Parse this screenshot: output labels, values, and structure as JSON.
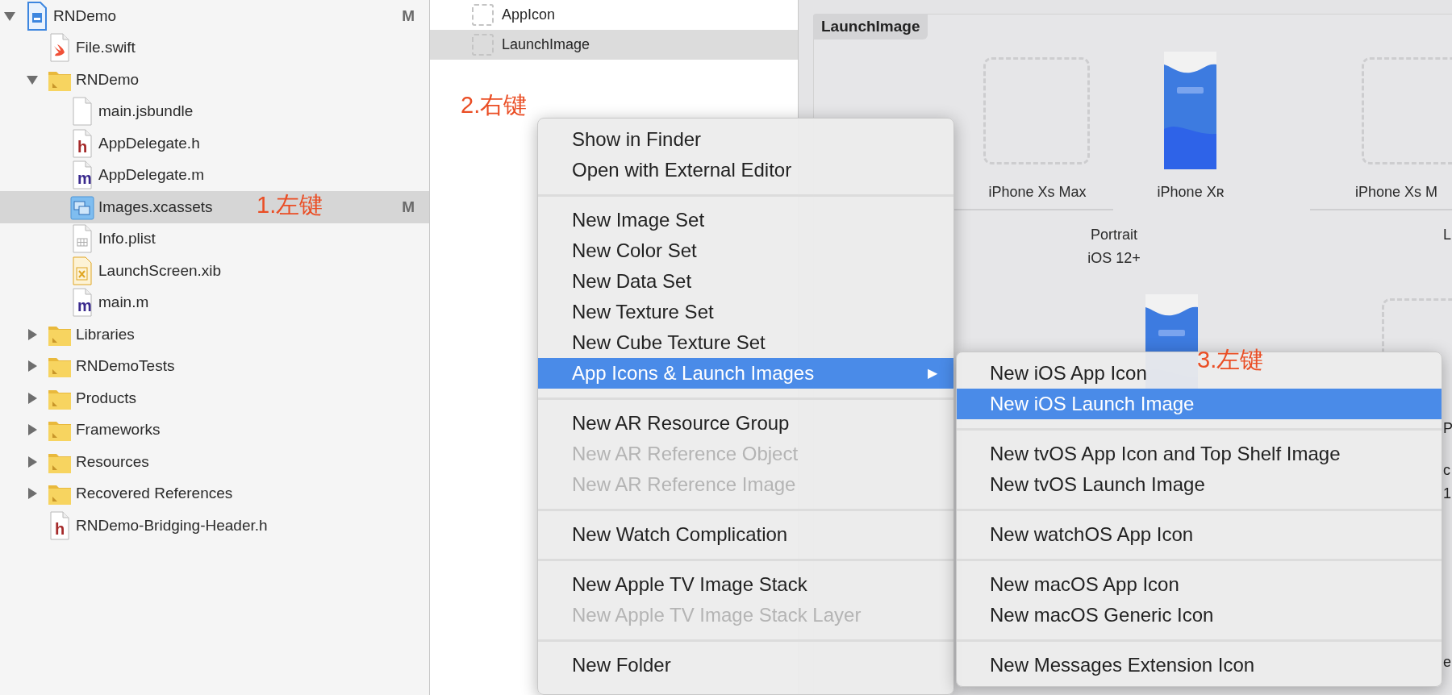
{
  "navigator": {
    "items": [
      {
        "name": "RNDemo",
        "kind": "project",
        "expanded": true,
        "selected": false,
        "status": "M",
        "children": [
          {
            "name": "File.swift",
            "kind": "swift",
            "selected": false
          },
          {
            "name": "RNDemo",
            "kind": "folder",
            "expanded": true,
            "selected": false,
            "children": [
              {
                "name": "main.jsbundle",
                "kind": "file",
                "selected": false
              },
              {
                "name": "AppDelegate.h",
                "kind": "header",
                "glyph": "h",
                "selected": false
              },
              {
                "name": "AppDelegate.m",
                "kind": "objc",
                "glyph": "m",
                "selected": false
              },
              {
                "name": "Images.xcassets",
                "kind": "assets",
                "selected": true,
                "status": "M"
              },
              {
                "name": "Info.plist",
                "kind": "plist",
                "selected": false
              },
              {
                "name": "LaunchScreen.xib",
                "kind": "xib",
                "selected": false
              },
              {
                "name": "main.m",
                "kind": "objc",
                "glyph": "m",
                "selected": false
              }
            ]
          },
          {
            "name": "Libraries",
            "kind": "folder",
            "expanded": false,
            "selected": false
          },
          {
            "name": "RNDemoTests",
            "kind": "folder",
            "expanded": false,
            "selected": false
          },
          {
            "name": "Products",
            "kind": "folder",
            "expanded": false,
            "selected": false
          },
          {
            "name": "Frameworks",
            "kind": "folder",
            "expanded": false,
            "selected": false
          },
          {
            "name": "Resources",
            "kind": "folder",
            "expanded": false,
            "selected": false
          },
          {
            "name": "Recovered References",
            "kind": "folder",
            "expanded": false,
            "selected": false
          },
          {
            "name": "RNDemo-Bridging-Header.h",
            "kind": "header",
            "glyph": "h",
            "selected": false
          }
        ]
      }
    ]
  },
  "asset_list": [
    {
      "name": "AppIcon",
      "selected": false
    },
    {
      "name": "LaunchImage",
      "selected": true
    }
  ],
  "canvas": {
    "title": "LaunchImage",
    "slots": [
      {
        "label": "iPhone Xs Max",
        "filled": false
      },
      {
        "label": "iPhone Xʀ",
        "filled": true
      },
      {
        "label": "iPhone Xs M",
        "filled": false
      },
      {
        "filled": true
      },
      {
        "filled": false
      }
    ],
    "groups": [
      {
        "orientation": "Portrait",
        "version": "iOS 12+"
      },
      {
        "orientation": "L"
      }
    ],
    "fragments": [
      "P",
      "c",
      "1",
      "e"
    ]
  },
  "context_menu": [
    {
      "kind": "item",
      "label": "Show in Finder",
      "disabled": false,
      "selected": false
    },
    {
      "kind": "item",
      "label": "Open with External Editor",
      "disabled": false,
      "selected": false
    },
    {
      "kind": "separator"
    },
    {
      "kind": "item",
      "label": "New Image Set",
      "disabled": false,
      "selected": false
    },
    {
      "kind": "item",
      "label": "New Color Set",
      "disabled": false,
      "selected": false
    },
    {
      "kind": "item",
      "label": "New Data Set",
      "disabled": false,
      "selected": false
    },
    {
      "kind": "item",
      "label": "New Texture Set",
      "disabled": false,
      "selected": false
    },
    {
      "kind": "item",
      "label": "New Cube Texture Set",
      "disabled": false,
      "selected": false
    },
    {
      "kind": "submenu",
      "label": "App Icons & Launch Images",
      "disabled": false,
      "selected": true,
      "arrow": "▶"
    },
    {
      "kind": "separator"
    },
    {
      "kind": "item",
      "label": "New AR Resource Group",
      "disabled": false,
      "selected": false
    },
    {
      "kind": "item",
      "label": "New AR Reference Object",
      "disabled": true,
      "selected": false
    },
    {
      "kind": "item",
      "label": "New AR Reference Image",
      "disabled": true,
      "selected": false
    },
    {
      "kind": "separator"
    },
    {
      "kind": "item",
      "label": "New Watch Complication",
      "disabled": false,
      "selected": false
    },
    {
      "kind": "separator"
    },
    {
      "kind": "item",
      "label": "New Apple TV Image Stack",
      "disabled": false,
      "selected": false
    },
    {
      "kind": "item",
      "label": "New Apple TV Image Stack Layer",
      "disabled": true,
      "selected": false
    },
    {
      "kind": "separator"
    },
    {
      "kind": "item",
      "label": "New Folder",
      "disabled": false,
      "selected": false
    }
  ],
  "submenu": [
    {
      "kind": "item",
      "label": "New iOS App Icon",
      "selected": false
    },
    {
      "kind": "item",
      "label": "New iOS Launch Image",
      "selected": true
    },
    {
      "kind": "separator"
    },
    {
      "kind": "item",
      "label": "New tvOS App Icon and Top Shelf Image",
      "selected": false
    },
    {
      "kind": "item",
      "label": "New tvOS Launch Image",
      "selected": false
    },
    {
      "kind": "separator"
    },
    {
      "kind": "item",
      "label": "New watchOS App Icon",
      "selected": false
    },
    {
      "kind": "separator"
    },
    {
      "kind": "item",
      "label": "New macOS App Icon",
      "selected": false
    },
    {
      "kind": "item",
      "label": "New macOS Generic Icon",
      "selected": false
    },
    {
      "kind": "separator"
    },
    {
      "kind": "item",
      "label": "New Messages Extension Icon",
      "selected": false
    }
  ],
  "annotations": [
    "1.左键",
    "2.右键",
    "3.左键"
  ]
}
